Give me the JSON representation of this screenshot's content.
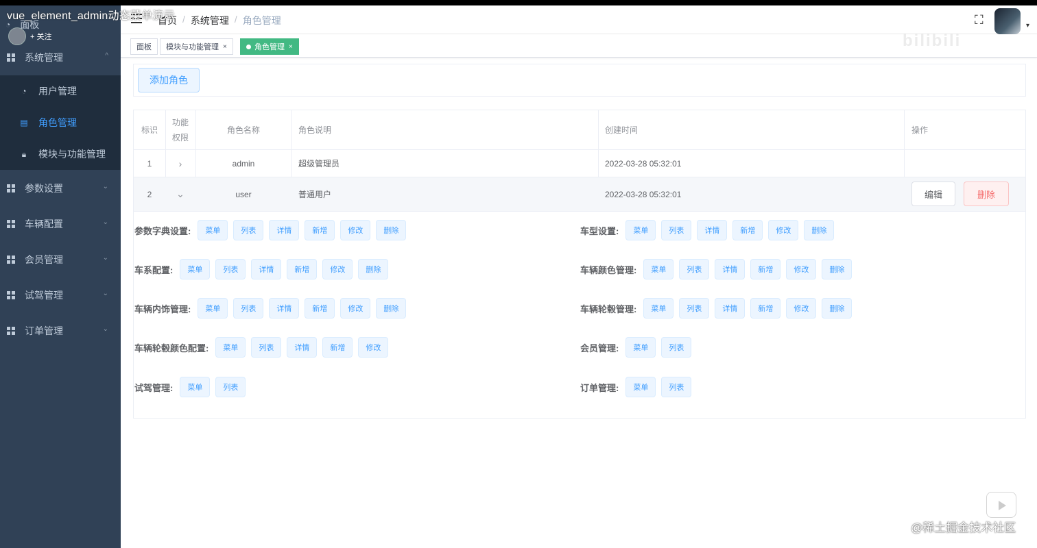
{
  "video": {
    "title": "vue_element_admin动态菜单演示",
    "follow": "+ 关注",
    "watermark": "@稀土掘金技术社区",
    "blogo": "bilibili"
  },
  "sidebar": {
    "top": {
      "label": "面板"
    },
    "system": {
      "label": "系统管理",
      "arrow": "^"
    },
    "subs": [
      {
        "label": "用户管理",
        "icon": "dashboard-icon"
      },
      {
        "label": "角色管理",
        "icon": "document-icon"
      },
      {
        "label": "模块与功能管理",
        "icon": "lock-icon"
      }
    ],
    "groups": [
      {
        "label": "参数设置"
      },
      {
        "label": "车辆配置"
      },
      {
        "label": "会员管理"
      },
      {
        "label": "试驾管理"
      },
      {
        "label": "订单管理"
      }
    ]
  },
  "navbar": {
    "crumbs": [
      "首页",
      "系统管理",
      "角色管理"
    ],
    "sep": "/"
  },
  "tags": [
    {
      "label": "面板"
    },
    {
      "label": "模块与功能管理"
    },
    {
      "label": "角色管理"
    }
  ],
  "toolbar": {
    "add": "添加角色"
  },
  "table": {
    "headers": {
      "id": "标识",
      "perm1": "功能",
      "perm2": "权限",
      "name": "角色名称",
      "desc": "角色说明",
      "time": "创建时间",
      "op": "操作"
    },
    "rows": [
      {
        "id": "1",
        "name": "admin",
        "desc": "超级管理员",
        "time": "2022-03-28 05:32:01",
        "toggle": "›"
      },
      {
        "id": "2",
        "name": "user",
        "desc": "普通用户",
        "time": "2022-03-28 05:32:01",
        "toggle": "⌄",
        "edit": "编辑",
        "del": "删除"
      }
    ]
  },
  "perms": {
    "p1": {
      "label": "参数字典设置:",
      "items": [
        "菜单",
        "列表",
        "详情",
        "新增",
        "修改",
        "删除"
      ]
    },
    "p2": {
      "label": "车型设置:",
      "items": [
        "菜单",
        "列表",
        "详情",
        "新增",
        "修改",
        "删除"
      ]
    },
    "p3": {
      "label": "车系配置:",
      "items": [
        "菜单",
        "列表",
        "详情",
        "新增",
        "修改",
        "删除"
      ]
    },
    "p4": {
      "label": "车辆颜色管理:",
      "items": [
        "菜单",
        "列表",
        "详情",
        "新增",
        "修改",
        "删除"
      ]
    },
    "p5": {
      "label": "车辆内饰管理:",
      "items": [
        "菜单",
        "列表",
        "详情",
        "新增",
        "修改",
        "删除"
      ]
    },
    "p6": {
      "label": "车辆轮毂管理:",
      "items": [
        "菜单",
        "列表",
        "详情",
        "新增",
        "修改",
        "删除"
      ]
    },
    "p7": {
      "label": "车辆轮毂颜色配置:",
      "items": [
        "菜单",
        "列表",
        "详情",
        "新增",
        "修改"
      ]
    },
    "p8": {
      "label": "会员管理:",
      "items": [
        "菜单",
        "列表"
      ]
    },
    "p9": {
      "label": "试驾管理:",
      "items": [
        "菜单",
        "列表"
      ]
    },
    "p10": {
      "label": "订单管理:",
      "items": [
        "菜单",
        "列表"
      ]
    }
  },
  "colors": {
    "sidebar": "#304156",
    "submenu": "#1f2d3d",
    "accent": "#409eff",
    "tagActive": "#42b983",
    "danger": "#f56c6c"
  }
}
